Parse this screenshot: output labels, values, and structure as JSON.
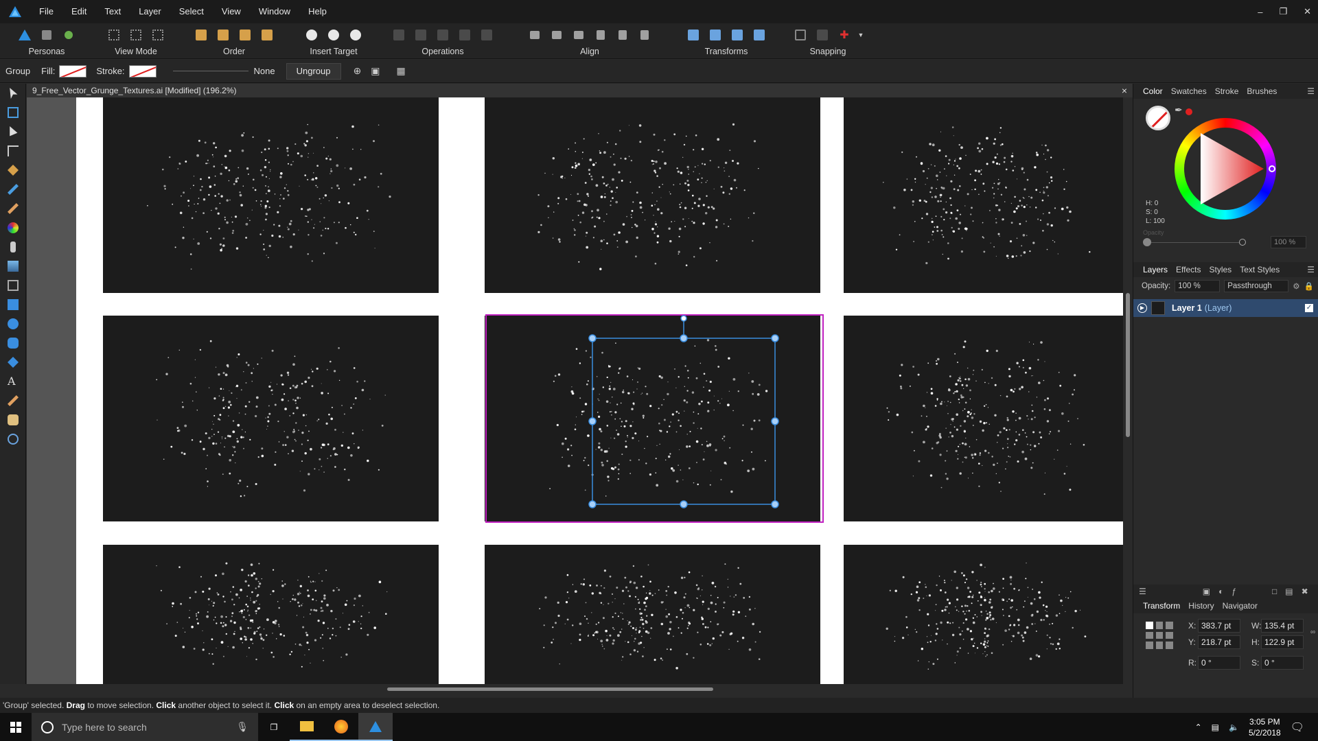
{
  "menu": [
    "File",
    "Edit",
    "Text",
    "Layer",
    "Select",
    "View",
    "Window",
    "Help"
  ],
  "toolbar": {
    "personas": "Personas",
    "view_mode": "View Mode",
    "order": "Order",
    "insert_target": "Insert Target",
    "operations": "Operations",
    "align": "Align",
    "transforms": "Transforms",
    "snapping": "Snapping"
  },
  "context": {
    "selection_type": "Group",
    "fill_label": "Fill:",
    "stroke_label": "Stroke:",
    "stroke_style": "None",
    "ungroup": "Ungroup"
  },
  "document": {
    "title": "9_Free_Vector_Grunge_Textures.ai [Modified] (196.2%)",
    "close": "×"
  },
  "color_panel": {
    "tabs": [
      "Color",
      "Swatches",
      "Stroke",
      "Brushes"
    ],
    "h": "H: 0",
    "s": "S: 0",
    "l": "L: 100",
    "opacity_label": "Opacity",
    "opacity": "100 %",
    "accent": "#e02020"
  },
  "layers_panel": {
    "tabs": [
      "Layers",
      "Effects",
      "Styles",
      "Text Styles"
    ],
    "opacity_label": "Opacity:",
    "opacity": "100 %",
    "blend_mode": "Passthrough",
    "layer_name": "Layer 1",
    "layer_type": "(Layer)"
  },
  "transform_panel": {
    "tabs": [
      "Transform",
      "History",
      "Navigator"
    ],
    "x": "383.7 pt",
    "y": "218.7 pt",
    "w": "135.4 pt",
    "h": "122.9 pt",
    "r": "0 °",
    "s": "0 °"
  },
  "status": {
    "prefix": "'Group' selected. ",
    "b1": "Drag",
    "t1": " to move selection. ",
    "b2": "Click",
    "t2": " another object to select it. ",
    "b3": "Click",
    "t3": " on an empty area to deselect selection."
  },
  "taskbar": {
    "search_placeholder": "Type here to search",
    "time": "3:05 PM",
    "date": "5/2/2018"
  }
}
